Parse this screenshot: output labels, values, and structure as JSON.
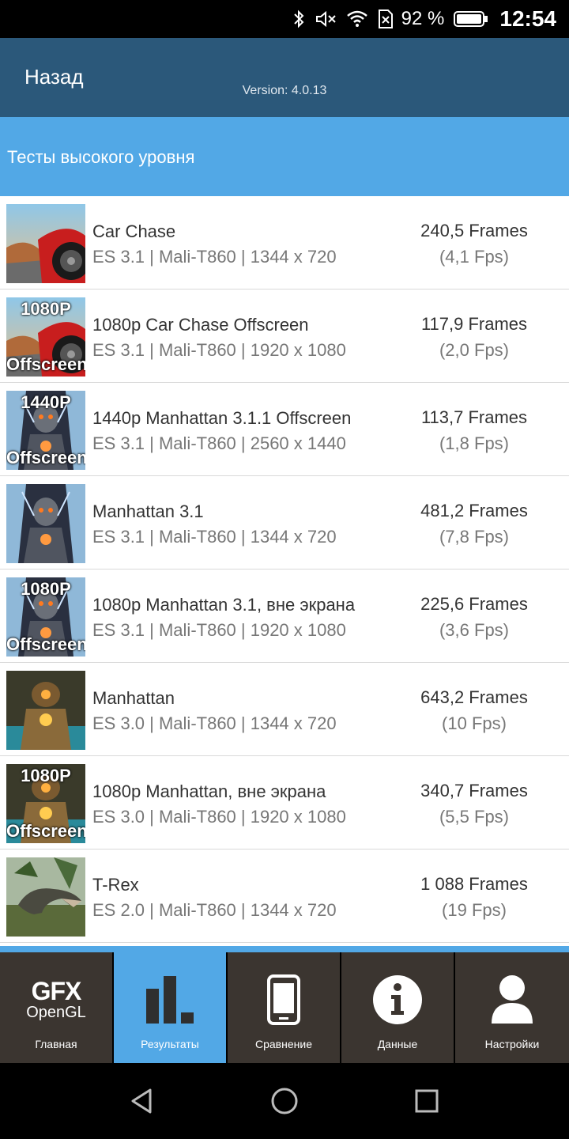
{
  "status_bar": {
    "battery_percent": "92 %",
    "time": "12:54",
    "icons": [
      "bluetooth-icon",
      "mute-icon",
      "wifi-icon",
      "sim-icon",
      "battery-icon"
    ]
  },
  "header": {
    "back_label": "Назад",
    "version": "Version: 4.0.13"
  },
  "section": {
    "title": "Тесты высокого уровня"
  },
  "tests": [
    {
      "name": "Car Chase",
      "desc": "ES 3.1 | Mali-T860 | 1344 x 720",
      "score": "240,5 Frames",
      "fps": "(4,1 Fps)",
      "thumb": "car-chase-thumbnail",
      "badge_top": "",
      "badge_bottom": ""
    },
    {
      "name": "1080p Car Chase Offscreen",
      "desc": "ES 3.1 | Mali-T860 | 1920 x 1080",
      "score": "117,9 Frames",
      "fps": "(2,0 Fps)",
      "thumb": "car-chase-thumbnail",
      "badge_top": "1080P",
      "badge_bottom": "Offscreen"
    },
    {
      "name": "1440p Manhattan 3.1.1 Offscreen",
      "desc": "ES 3.1 | Mali-T860 | 2560 x 1440",
      "score": "113,7 Frames",
      "fps": "(1,8 Fps)",
      "thumb": "manhattan31-thumbnail",
      "badge_top": "1440P",
      "badge_bottom": "Offscreen"
    },
    {
      "name": "Manhattan 3.1",
      "desc": "ES 3.1 | Mali-T860 | 1344 x 720",
      "score": "481,2 Frames",
      "fps": "(7,8 Fps)",
      "thumb": "manhattan31-thumbnail",
      "badge_top": "",
      "badge_bottom": ""
    },
    {
      "name": "1080p Manhattan 3.1, вне экрана",
      "desc": "ES 3.1 | Mali-T860 | 1920 x 1080",
      "score": "225,6 Frames",
      "fps": "(3,6 Fps)",
      "thumb": "manhattan31-thumbnail",
      "badge_top": "1080P",
      "badge_bottom": "Offscreen"
    },
    {
      "name": "Manhattan",
      "desc": "ES 3.0 | Mali-T860 | 1344 x 720",
      "score": "643,2 Frames",
      "fps": "(10 Fps)",
      "thumb": "manhattan-thumbnail",
      "badge_top": "",
      "badge_bottom": ""
    },
    {
      "name": "1080p Manhattan, вне экрана",
      "desc": "ES 3.0 | Mali-T860 | 1920 x 1080",
      "score": "340,7 Frames",
      "fps": "(5,5 Fps)",
      "thumb": "manhattan-thumbnail",
      "badge_top": "1080P",
      "badge_bottom": "Offscreen"
    },
    {
      "name": "T-Rex",
      "desc": "ES 2.0 | Mali-T860 | 1344 x 720",
      "score": "1 088 Frames",
      "fps": "(19 Fps)",
      "thumb": "trex-thumbnail",
      "badge_top": "",
      "badge_bottom": ""
    }
  ],
  "tabs": [
    {
      "label": "Главная",
      "icon": "gfx-opengl-logo",
      "logo_line1": "GFX",
      "logo_line2": "OpenGL",
      "active": false
    },
    {
      "label": "Результаты",
      "icon": "bar-chart-icon",
      "active": true
    },
    {
      "label": "Сравнение",
      "icon": "phone-icon",
      "active": false
    },
    {
      "label": "Данные",
      "icon": "info-icon",
      "active": false
    },
    {
      "label": "Настройки",
      "icon": "user-icon",
      "active": false
    }
  ],
  "nav": {
    "buttons": [
      "back-icon",
      "home-icon",
      "recents-icon"
    ]
  },
  "colors": {
    "header_bg": "#2b587a",
    "section_bg": "#52a8e6",
    "tab_bg": "#3b3530",
    "tab_active_bg": "#52a8e6"
  }
}
